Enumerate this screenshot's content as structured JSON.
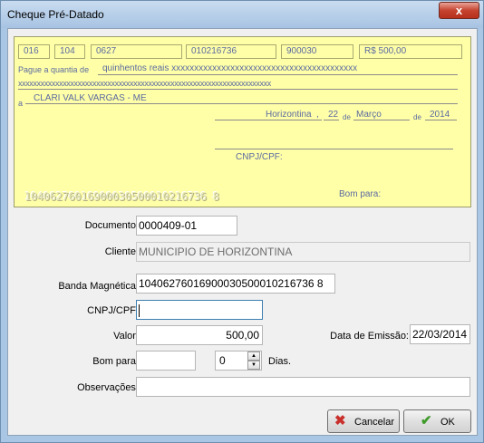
{
  "window": {
    "title": "Cheque Pré-Datado",
    "close_glyph": "x"
  },
  "cheque": {
    "boxes": [
      "016",
      "104",
      "0627",
      "010216736",
      "900030",
      "R$ 500,00"
    ],
    "pague_label": "Pague a quantia de",
    "amount_words": "quinhentos reais xxxxxxxxxxxxxxxxxxxxxxxxxxxxxxxxxxxxxxxxx",
    "amount_words_line2": "xxxxxxxxxxxxxxxxxxxxxxxxxxxxxxxxxxxxxxxxxxxxxxxxxxxxxxxxxxxxxxxxxxxx",
    "a_label": "a",
    "payee": "CLARI VALK VARGAS - ME",
    "city": "Horizontina",
    "comma": ",",
    "day": "22",
    "de1": "de",
    "month": "Março",
    "de2": "de",
    "year": "2014",
    "cnpj_label": "CNPJ/CPF:",
    "micr": "10406276016900030500010216736 8",
    "bom_para_label": "Bom para:"
  },
  "form": {
    "documento": {
      "label": "Documento:",
      "value": "0000409-01"
    },
    "cliente": {
      "label": "Cliente:",
      "value": "MUNICIPIO DE HORIZONTINA"
    },
    "banda": {
      "label": "Banda Magnética:",
      "value": "10406276016900030500010216736 8"
    },
    "cnpj": {
      "label": "CNPJ/CPF:",
      "value": ""
    },
    "valor": {
      "label": "Valor:",
      "value": "500,00"
    },
    "data_emissao": {
      "label": "Data de Emissão:",
      "value": "22/03/2014"
    },
    "bom_para": {
      "label": "Bom para:",
      "value": ""
    },
    "dias": {
      "value": "0",
      "suffix": "Dias."
    },
    "observacoes": {
      "label": "Observações:",
      "value": ""
    }
  },
  "buttons": {
    "cancelar": {
      "label": "Cancelar",
      "icon": "red-x-icon",
      "color": "#c9302c"
    },
    "ok": {
      "label": "OK",
      "icon": "green-check-icon",
      "color": "#3f9a2a"
    }
  }
}
